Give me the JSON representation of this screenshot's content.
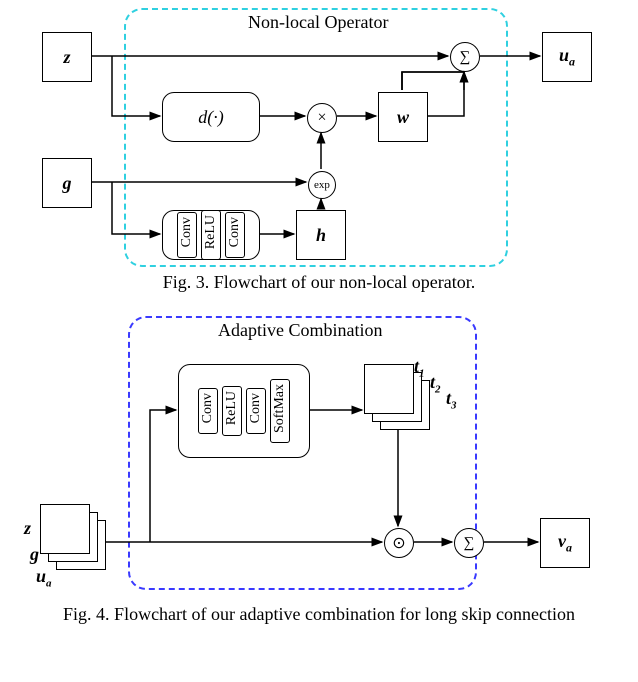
{
  "fig3": {
    "region_title": "Non-local Operator",
    "z": "z",
    "g": "g",
    "d": "d(·)",
    "h": "h",
    "w": "w",
    "ua": "u",
    "ua_sub": "a",
    "conv1": "Conv",
    "relu": "ReLU",
    "conv2": "Conv",
    "exp": "exp",
    "mult": "×",
    "sum": "∑",
    "caption": "Fig. 3. Flowchart of our non-local operator."
  },
  "fig4": {
    "region_title": "Adaptive Combination",
    "z": "z",
    "g": "g",
    "ua": "u",
    "ua_sub": "a",
    "t1": "t",
    "t2": "t",
    "t3": "t",
    "sub1": "1",
    "sub2": "2",
    "sub3": "3",
    "conv1": "Conv",
    "relu": "ReLU",
    "conv2": "Conv",
    "softmax": "SoftMax",
    "dot": "⊙",
    "sum": "∑",
    "va": "v",
    "va_sub": "a",
    "caption": "Fig. 4. Flowchart of our adaptive combination for long skip connection"
  }
}
